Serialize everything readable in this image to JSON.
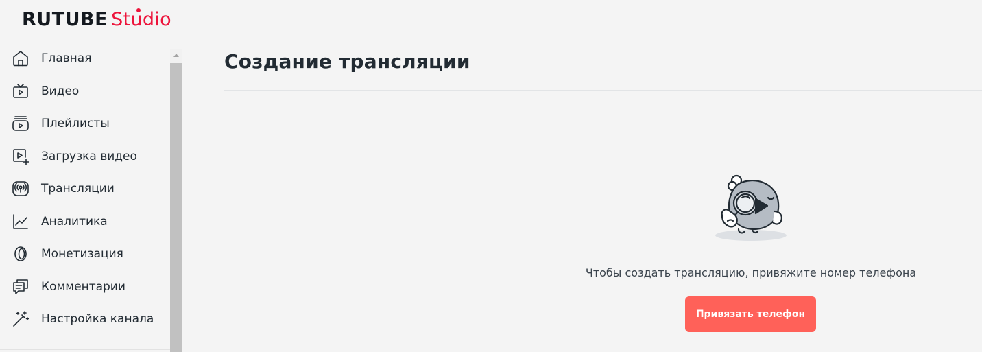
{
  "brand": {
    "name": "RUTUBE",
    "product": "Studio",
    "accent_color": "#ed143b"
  },
  "sidebar": {
    "items": [
      {
        "label": "Главная",
        "icon": "home-icon"
      },
      {
        "label": "Видео",
        "icon": "tv-play-icon"
      },
      {
        "label": "Плейлисты",
        "icon": "playlist-icon"
      },
      {
        "label": "Загрузка видео",
        "icon": "upload-video-icon"
      },
      {
        "label": "Трансляции",
        "icon": "broadcast-icon"
      },
      {
        "label": "Аналитика",
        "icon": "analytics-icon"
      },
      {
        "label": "Монетизация",
        "icon": "coin-icon"
      },
      {
        "label": "Комментарии",
        "icon": "comments-icon"
      },
      {
        "label": "Настройка канала",
        "icon": "magic-wand-icon"
      }
    ]
  },
  "main": {
    "title": "Создание трансляции",
    "illustration": "magnifier-mascot-illustration",
    "message": "Чтобы создать трансляцию, привяжите номер телефона",
    "button_label": "Привязать телефон",
    "button_color": "#ff6159"
  }
}
